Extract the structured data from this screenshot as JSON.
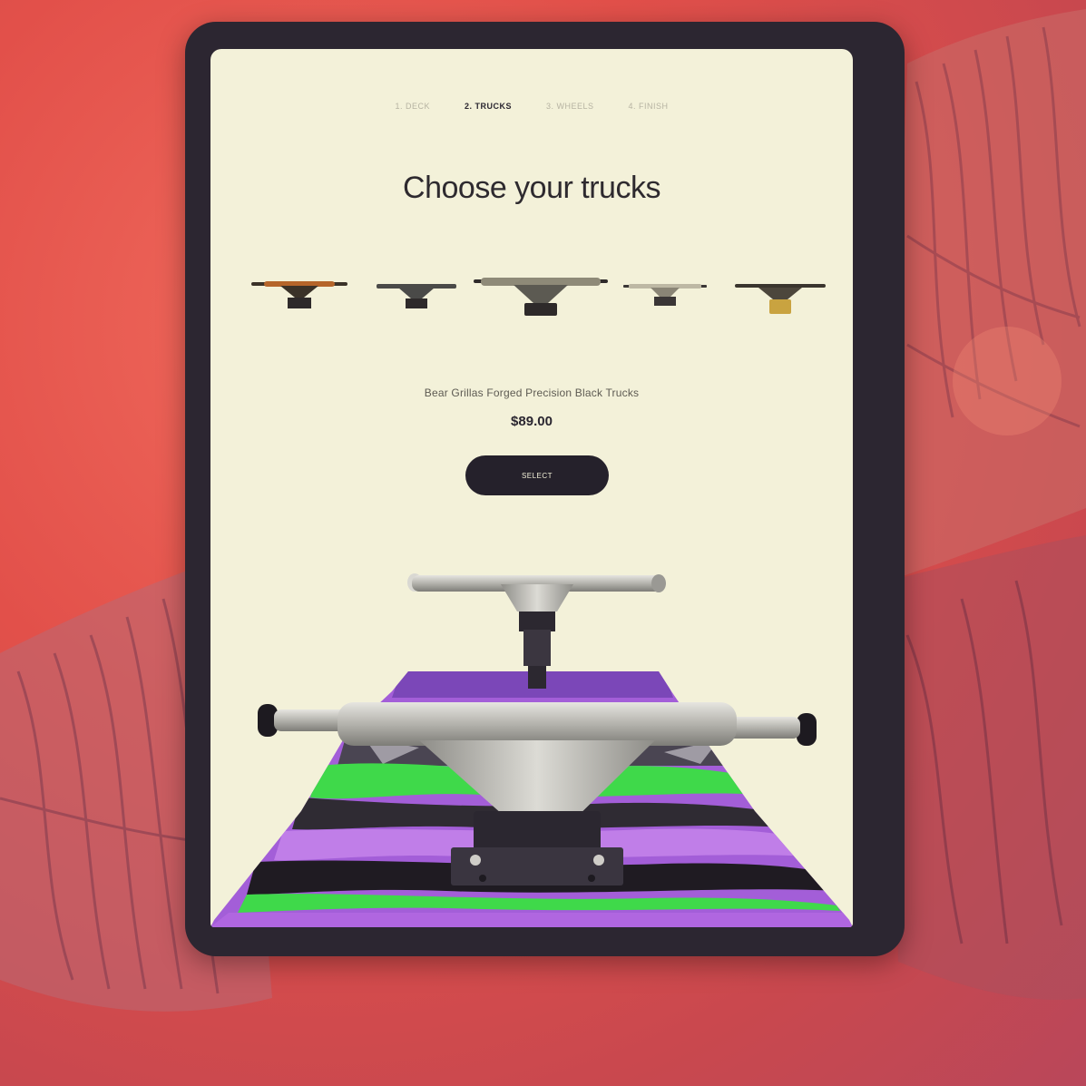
{
  "steps": [
    {
      "label": "1. DECK",
      "active": false
    },
    {
      "label": "2. TRUCKS",
      "active": true
    },
    {
      "label": "3. WHEELS",
      "active": false
    },
    {
      "label": "4. FINISH",
      "active": false
    }
  ],
  "title": "Choose your trucks",
  "product": {
    "name": "Bear Grillas Forged Precision Black Trucks",
    "price": "$89.00"
  },
  "select_button": "SELECT",
  "truck_options": [
    {
      "name": "truck-option-1",
      "hanger_color": "#3a3228",
      "base_color": "#2e2a2a",
      "accent": "#b5652a"
    },
    {
      "name": "truck-option-2",
      "hanger_color": "#4a4a48",
      "base_color": "#2e2a2a",
      "accent": "#6b6b66"
    },
    {
      "name": "truck-option-3",
      "hanger_color": "#5c5a52",
      "base_color": "#2e2a2a",
      "accent": "#8e8a78"
    },
    {
      "name": "truck-option-4",
      "hanger_color": "#8a8576",
      "base_color": "#3a3636",
      "accent": "#bdb8a4"
    },
    {
      "name": "truck-option-5",
      "hanger_color": "#3a352e",
      "base_color": "#c9a340",
      "accent": "#4c463c"
    }
  ],
  "colors": {
    "background": "#e2504a",
    "screen": "#f3f1d9",
    "button": "#25212b",
    "deck_purple": "#a35ed8",
    "deck_green": "#3fd94a",
    "truck_silver": "#bdbcb6"
  }
}
